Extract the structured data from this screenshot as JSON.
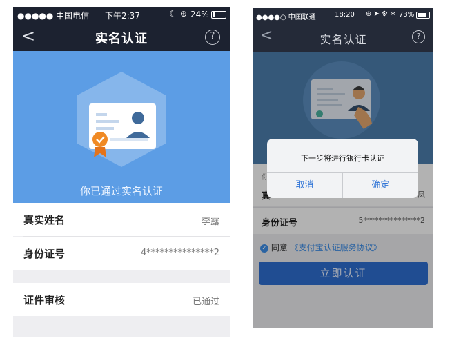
{
  "screen1": {
    "status": {
      "carrier": "●●●●● 中国电信",
      "time": "下午2:37",
      "battery": "24%"
    },
    "nav": {
      "title": "实名认证",
      "back": "<",
      "help": "?"
    },
    "banner": {
      "message": "你已通过实名认证"
    },
    "rows": [
      {
        "label": "真实姓名",
        "value": "李露"
      },
      {
        "label": "身份证号",
        "value": "4***************2"
      },
      {
        "label": "证件审核",
        "value": "已通过"
      }
    ]
  },
  "screen2": {
    "status": {
      "carrier": "●●●●○ 中国联通",
      "time": "18:20",
      "battery": "73%"
    },
    "nav": {
      "title": "实名认证",
      "back": "<",
      "help": "?"
    },
    "rows": [
      {
        "label": "你",
        "value": ""
      },
      {
        "label": "真",
        "value": "凤"
      },
      {
        "label": "身份证号",
        "value": "5***************2"
      }
    ],
    "agree": {
      "text": "同意",
      "link": "《支付宝认证服务协议》"
    },
    "submit_label": "立即认证",
    "dialog": {
      "message": "下一步将进行银行卡认证",
      "cancel": "取消",
      "confirm": "确定"
    }
  },
  "colors": {
    "accent": "#5c9de5",
    "primary_button": "#2f6fd1",
    "nav_bg": "#1c2230",
    "link": "#3d8ee8"
  }
}
